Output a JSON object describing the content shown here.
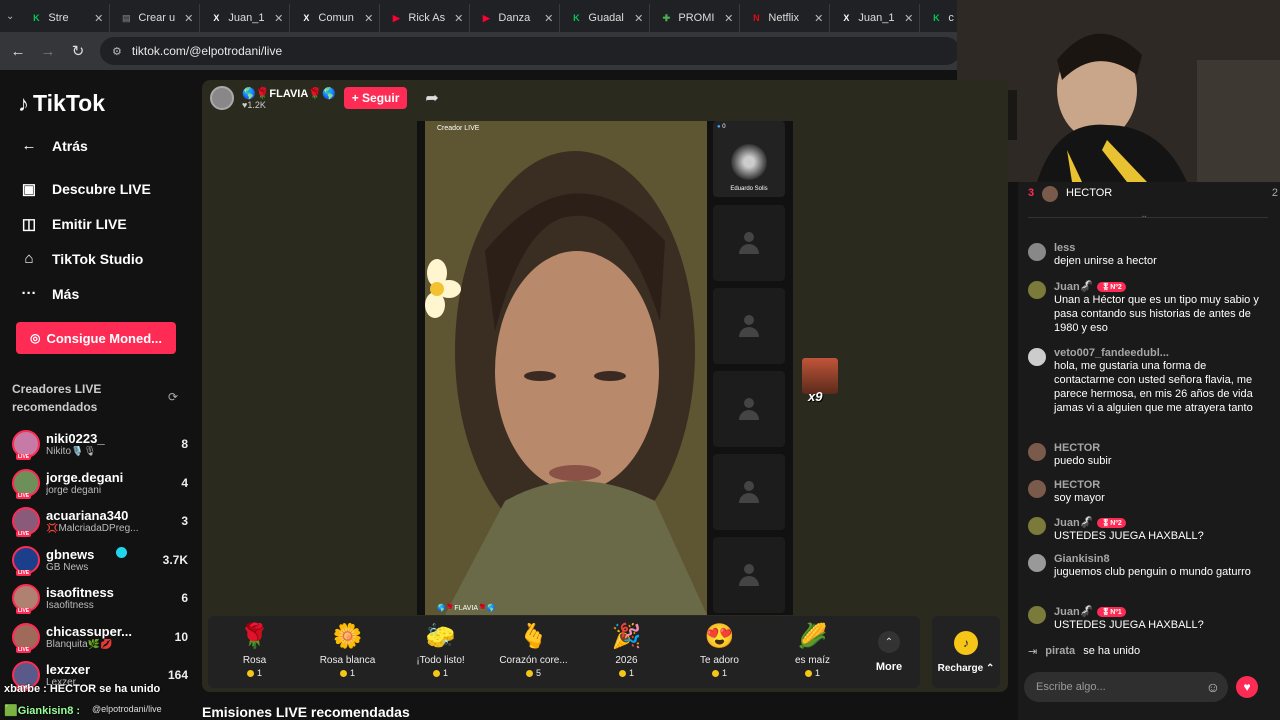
{
  "browser": {
    "tabs": [
      {
        "title": "Stre",
        "color": "#00c853",
        "glyph": "K"
      },
      {
        "title": "Crear u",
        "color": "#666",
        "glyph": "▤"
      },
      {
        "title": "Juan_1",
        "color": "#fff",
        "glyph": "X"
      },
      {
        "title": "Comun",
        "color": "#fff",
        "glyph": "X"
      },
      {
        "title": "Rick As",
        "color": "#ff0033",
        "glyph": "▶"
      },
      {
        "title": "Danza",
        "color": "#ff0033",
        "glyph": "▶"
      },
      {
        "title": "Guadal",
        "color": "#00c853",
        "glyph": "K"
      },
      {
        "title": "PROMI",
        "color": "#4caf50",
        "glyph": "✚"
      },
      {
        "title": "Netflix",
        "color": "#e50914",
        "glyph": "N"
      },
      {
        "title": "Juan_1",
        "color": "#fff",
        "glyph": "X"
      },
      {
        "title": "c",
        "color": "#00c853",
        "glyph": "K"
      }
    ],
    "url": "tiktok.com/@elpotrodani/live"
  },
  "sidebar": {
    "logo": "TikTok",
    "nav": [
      {
        "label": "Atrás",
        "icon": "←"
      },
      {
        "label": "Descubre LIVE",
        "icon": "▣"
      },
      {
        "label": "Emitir LIVE",
        "icon": "◫"
      },
      {
        "label": "TikTok Studio",
        "icon": "⌂"
      },
      {
        "label": "Más",
        "icon": "···"
      }
    ],
    "coins_button": "Consigue Moned...",
    "recommended_title": "Creadores LIVE recomendados",
    "creators": [
      {
        "name": "niki0223_",
        "sub": "Nikito🎙️🎙",
        "count": "8",
        "color": "#c87aa6"
      },
      {
        "name": "jorge.degani",
        "sub": "jorge degani",
        "count": "4",
        "color": "#6f8f5a"
      },
      {
        "name": "acuariana340",
        "sub": "💢MalcriadaDPreg...",
        "count": "3",
        "color": "#8a5a7a"
      },
      {
        "name": "gbnews",
        "sub": "GB News",
        "count": "3.7K",
        "color": "#1b3f8b"
      },
      {
        "name": "isaofitness",
        "sub": "Isaofitness",
        "count": "6",
        "color": "#b08070"
      },
      {
        "name": "chicassuper...",
        "sub": "Blanquita🌿💋",
        "count": "10",
        "color": "#a06a5a"
      },
      {
        "name": "lexzxer",
        "sub": "Lexzer",
        "count": "164",
        "color": "#5a5a8a"
      }
    ],
    "overlay_joined": "xbarbe : HECTOR se ha unido",
    "overlay_user": "🟩Giankisin8 :",
    "overlay_url": "@elpotrodani/live"
  },
  "stream": {
    "host_name": "🌎🌹FLAVIA🌹🌎",
    "host_likes": "♥1.2K",
    "follow": "+ Seguir",
    "creator_label": "Creador LIVE",
    "bottom_label": "🌎🌹FLAVIA🌹🌎",
    "guest_name": "Eduardo Solis",
    "guest_count": "0",
    "gift_count": "x9",
    "gifts": [
      {
        "name": "Rosa",
        "price": "1",
        "icon": "🌹"
      },
      {
        "name": "Rosa blanca",
        "price": "1",
        "icon": "🌼"
      },
      {
        "name": "¡Todo listo!",
        "price": "1",
        "icon": "🧽"
      },
      {
        "name": "Corazón core...",
        "price": "5",
        "icon": "🫰"
      },
      {
        "name": "2026",
        "price": "1",
        "icon": "🎉"
      },
      {
        "name": "Te adoro",
        "price": "1",
        "icon": "😍"
      },
      {
        "name": "es maíz",
        "price": "1",
        "icon": "🌽"
      }
    ],
    "more": "More",
    "recharge": "Recharge ⌃",
    "recommended": "Emisiones LIVE recomendadas"
  },
  "chat": {
    "leader_rank": "3",
    "leader_name": "HECTOR",
    "leader_score": "2",
    "messages": [
      {
        "user": "less",
        "badge": "",
        "text": "dejen unirse a hector",
        "color": "#888"
      },
      {
        "user": "Juan🦨",
        "badge": "🎖Nº2",
        "text": "Unan a Héctor que es un tipo muy sabio y pasa contando sus historias de antes de 1980 y eso",
        "color": "#7a7a3a"
      },
      {
        "user": "veto007_fandeedubl...",
        "badge": "",
        "text": "hola, me gustaria una forma de contactarme con usted señora flavia, me parece hermosa, en mis 26 años de vida jamas vi a alguien que me atrayera tanto",
        "color": "#ccc"
      },
      {
        "user": "HECTOR",
        "badge": "",
        "text": "puedo subir",
        "color": "#7a5a4a"
      },
      {
        "user": "HECTOR",
        "badge": "",
        "text": "soy mayor",
        "color": "#7a5a4a"
      },
      {
        "user": "Juan🦨",
        "badge": "🎖Nº2",
        "text": "USTEDES JUEGA HAXBALL?",
        "color": "#7a7a3a"
      },
      {
        "user": "Giankisin8",
        "badge": "",
        "text": "juguemos club penguin o mundo gaturro",
        "color": "#999"
      },
      {
        "user": "Juan🦨",
        "badge": "🎖Nº1",
        "text": "USTEDES JUEGA HAXBALL?",
        "color": "#7a7a3a"
      }
    ],
    "join_user": "pirata",
    "join_text": "se ha unido",
    "placeholder": "Escribe algo..."
  }
}
